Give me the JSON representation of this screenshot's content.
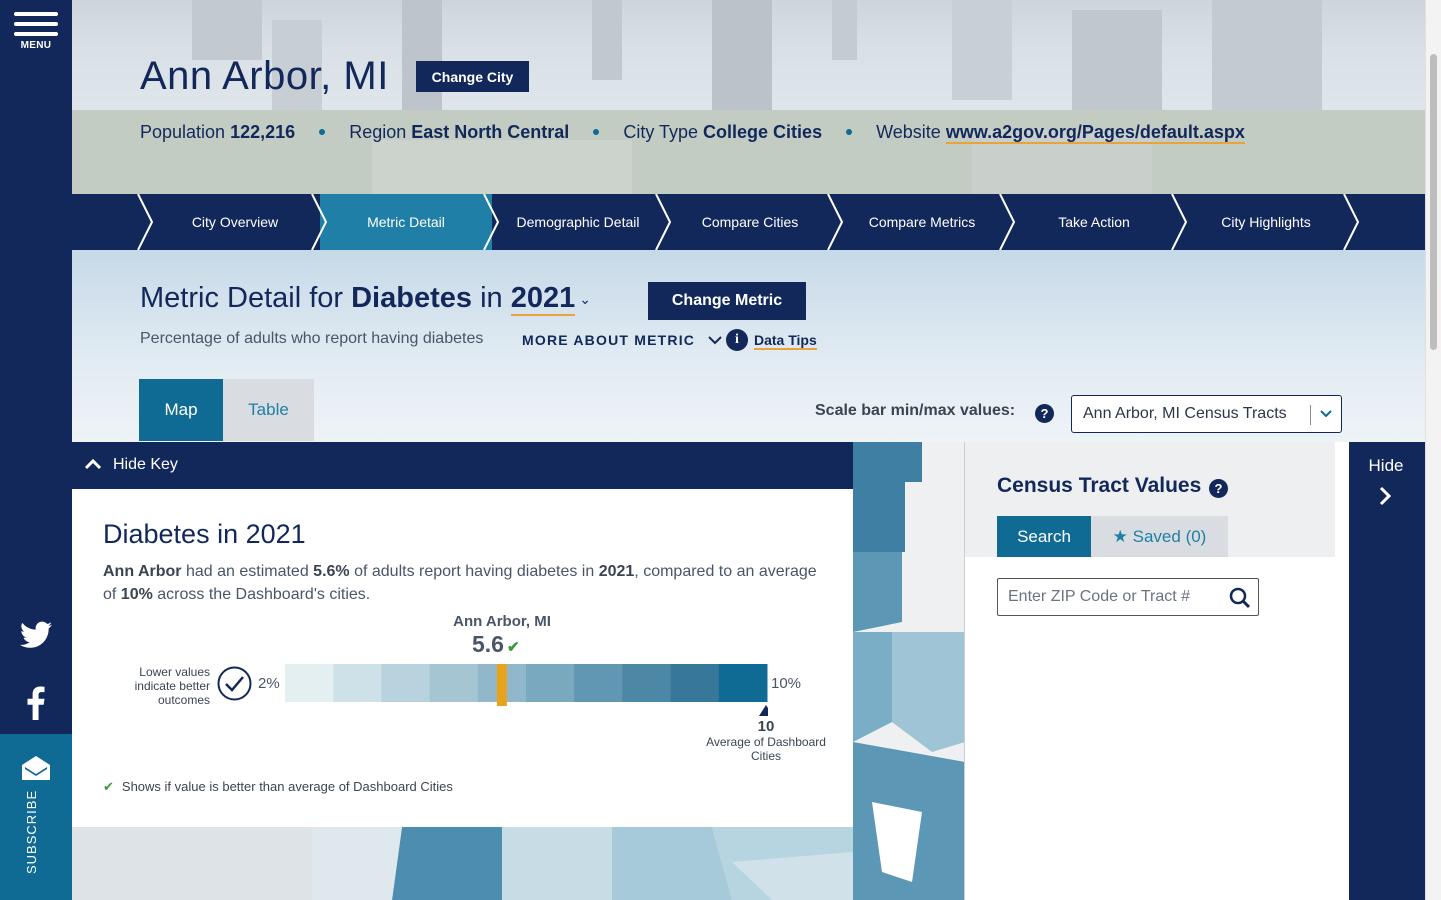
{
  "sidebar": {
    "menu_label": "MENU",
    "subscribe_label": "SUBSCRIBE"
  },
  "header": {
    "city_name": "Ann Arbor, MI",
    "change_city_label": "Change City",
    "population_label": "Population",
    "population_value": "122,216",
    "region_label": "Region",
    "region_value": "East North Central",
    "city_type_label": "City Type",
    "city_type_value": "College Cities",
    "website_label": "Website",
    "website_value": "www.a2gov.org/Pages/default.aspx"
  },
  "nav": {
    "items": [
      {
        "label": "City Overview"
      },
      {
        "label": "Metric Detail"
      },
      {
        "label": "Demographic Detail"
      },
      {
        "label": "Compare Cities"
      },
      {
        "label": "Compare Metrics"
      },
      {
        "label": "Take Action"
      },
      {
        "label": "City Highlights"
      }
    ],
    "active": "Metric Detail"
  },
  "metric": {
    "title_prefix": "Metric Detail for",
    "metric_name": "Diabetes",
    "in_word": "in",
    "year": "2021",
    "change_metric_label": "Change Metric",
    "description": "Percentage of adults who report having diabetes",
    "more_about_label": "MORE ABOUT METRIC",
    "data_tips_label": "Data Tips",
    "data_tips_icon": "i",
    "tabs": {
      "map": "Map",
      "table": "Table"
    },
    "active_tab": "Map",
    "scale_label": "Scale bar min/max values:",
    "help_glyph": "?",
    "scale_select_value": "Ann Arbor, MI Census Tracts"
  },
  "key": {
    "hide_key_label": "Hide Key",
    "title": "Diabetes in 2021",
    "text_city": "Ann Arbor",
    "text_1": "had an estimated",
    "text_value": "5.6%",
    "text_2": "of adults report having diabetes in",
    "text_year": "2021",
    "text_3": ", compared to an average of",
    "text_avg": "10%",
    "text_4": "across the Dashboard's cities.",
    "city_label": "Ann Arbor, MI",
    "city_value": "5.6",
    "lower_values_note": "Lower values indicate better outcomes",
    "min_label": "2%",
    "max_label": "10%",
    "average_value": "10",
    "average_label": "Average of Dashboard Cities",
    "better_note": "Shows if value is better than average of Dashboard Cities",
    "scale_min": 2,
    "scale_max": 10,
    "marker_value": 5.6,
    "bins": 10,
    "colors": {
      "bins": [
        "#e4eff2",
        "#cfe1e8",
        "#b9d3de",
        "#a5c5d3",
        "#90b8ca",
        "#79a9bf",
        "#6197b2",
        "#4c87a6",
        "#37789a",
        "#0f6b94"
      ],
      "marker": "#e8a31d",
      "check": "#3a9a3a"
    }
  },
  "census": {
    "title": "Census Tract Values",
    "search_tab": "Search",
    "saved_tab": "Saved (0)",
    "input_placeholder": "Enter ZIP Code or Tract #"
  },
  "right_panel": {
    "hide_label": "Hide"
  },
  "colors": {
    "navy": "#13285a",
    "teal": "#0f6b94",
    "active_tab": "#1f7fa6",
    "accent_underline": "#e8a33c"
  }
}
